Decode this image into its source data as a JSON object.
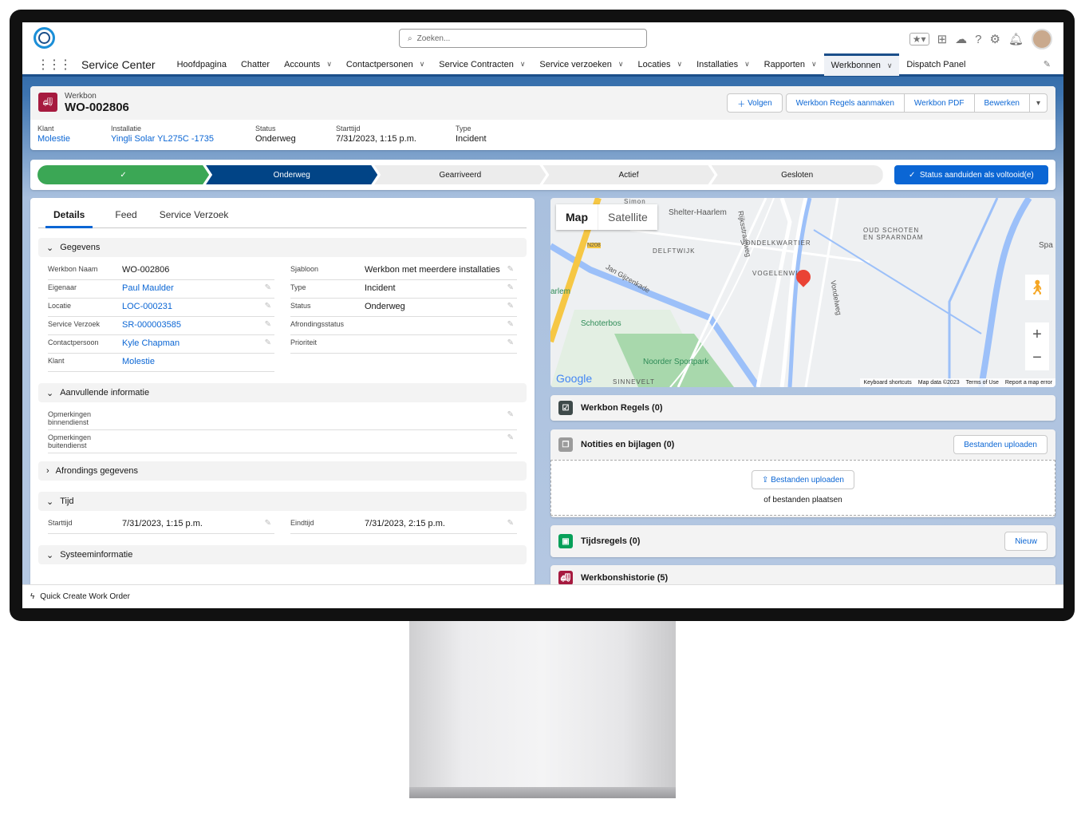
{
  "header": {
    "search_placeholder": "Zoeken...",
    "app_name": "Service Center"
  },
  "nav": {
    "items": [
      {
        "label": "Hoofdpagina",
        "dropdown": false
      },
      {
        "label": "Chatter",
        "dropdown": false
      },
      {
        "label": "Accounts",
        "dropdown": true
      },
      {
        "label": "Contactpersonen",
        "dropdown": true
      },
      {
        "label": "Service Contracten",
        "dropdown": true
      },
      {
        "label": "Service verzoeken",
        "dropdown": true
      },
      {
        "label": "Locaties",
        "dropdown": true
      },
      {
        "label": "Installaties",
        "dropdown": true
      },
      {
        "label": "Rapporten",
        "dropdown": true
      },
      {
        "label": "Werkbonnen",
        "dropdown": true,
        "active": true
      },
      {
        "label": "Dispatch Panel",
        "dropdown": false
      }
    ]
  },
  "record": {
    "object": "Werkbon",
    "title": "WO-002806",
    "buttons": {
      "follow": "Volgen",
      "create_lines": "Werkbon Regels aanmaken",
      "pdf": "Werkbon PDF",
      "edit": "Bewerken"
    },
    "highlights": [
      {
        "label": "Klant",
        "value": "Molestie",
        "link": true
      },
      {
        "label": "Installatie",
        "value": "Yingli Solar YL275C -1735",
        "link": true
      },
      {
        "label": "Status",
        "value": "Onderweg"
      },
      {
        "label": "Starttijd",
        "value": "7/31/2023, 1:15 p.m."
      },
      {
        "label": "Type",
        "value": "Incident"
      }
    ]
  },
  "path": {
    "steps": [
      "✓",
      "Onderweg",
      "Gearriveerd",
      "Actief",
      "Gesloten"
    ],
    "complete_button": "Status aanduiden als voltooid(e)"
  },
  "tabs": [
    "Details",
    "Feed",
    "Service Verzoek"
  ],
  "sections": {
    "gegevens": "Gegevens",
    "aanvullend": "Aanvullende informatie",
    "afronding": "Afrondings gegevens",
    "tijd": "Tijd",
    "systeem": "Systeeminformatie"
  },
  "fields_left": [
    {
      "label": "Werkbon Naam",
      "value": "WO-002806"
    },
    {
      "label": "Eigenaar",
      "value": "Paul Maulder",
      "link": true
    },
    {
      "label": "Locatie",
      "value": "LOC-000231",
      "link": true
    },
    {
      "label": "Service Verzoek",
      "value": "SR-000003585",
      "link": true
    },
    {
      "label": "Contactpersoon",
      "value": "Kyle Chapman",
      "link": true
    },
    {
      "label": "Klant",
      "value": "Molestie",
      "link": true
    }
  ],
  "fields_right": [
    {
      "label": "Sjabloon",
      "value": "Werkbon met meerdere installaties"
    },
    {
      "label": "Type",
      "value": "Incident"
    },
    {
      "label": "Status",
      "value": "Onderweg"
    },
    {
      "label": "Afrondingsstatus",
      "value": ""
    },
    {
      "label": "Prioriteit",
      "value": ""
    }
  ],
  "fields_extra": [
    {
      "label": "Opmerkingen binnendienst"
    },
    {
      "label": "Opmerkingen buitendienst"
    }
  ],
  "time": {
    "start_label": "Starttijd",
    "start": "7/31/2023, 1:15 p.m.",
    "end_label": "Eindtijd",
    "end": "7/31/2023, 2:15 p.m."
  },
  "map": {
    "tab_map": "Map",
    "tab_satellite": "Satellite",
    "labels": [
      "Shelter-Haarlem",
      "VONDELKWARTIER",
      "DELFTWIJK",
      "VOGELENWIJK",
      "OUD SCHOTEN EN SPAARNDAM",
      "Schoterbos",
      "Noorder Sportpark",
      "Jan Gijzenkade",
      "Rijksstraatweg",
      "Vondelweg",
      "SINNEVELT",
      "Simon",
      "N208",
      "arlem",
      "Spa"
    ],
    "footer": [
      "Keyboard shortcuts",
      "Map data ©2023",
      "Terms of Use",
      "Report a map error"
    ]
  },
  "related": {
    "regels": "Werkbon Regels (0)",
    "notities": "Notities en bijlagen (0)",
    "upload": "Bestanden uploaden",
    "drop": "of bestanden plaatsen",
    "tijd": "Tijdsregels (0)",
    "nieuw": "Nieuw",
    "historie": "Werkbonshistorie (5)"
  },
  "utility": {
    "quick_create": "Quick Create Work Order"
  },
  "colors": {
    "brand": "#0b66d4",
    "nav_active": "#1b4f8a",
    "path_done": "#3ba755",
    "path_current": "#014486",
    "workorder_icon": "#a61a3f"
  }
}
